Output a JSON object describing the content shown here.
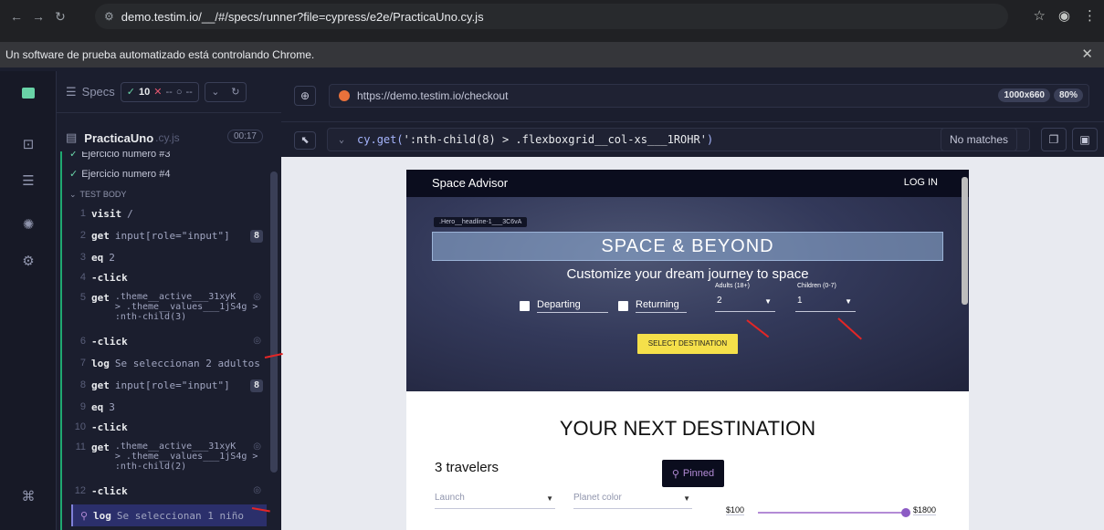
{
  "browser": {
    "url": "demo.testim.io/__/#/specs/runner?file=cypress/e2e/PracticaUno.cy.js",
    "automation_banner": "Un software de prueba automatizado está controlando Chrome."
  },
  "reporter": {
    "specs_label": "Specs",
    "passed": "10",
    "failed": "--",
    "pending": "--",
    "spec_name": "PracticaUno",
    "spec_ext": ".cy.js",
    "duration": "00:17",
    "test_prev": "Ejercicio numero #3",
    "test_current": "Ejercicio numero #4",
    "section": "TEST BODY",
    "commands": [
      {
        "num": "1",
        "name": "visit",
        "msg": "/"
      },
      {
        "num": "2",
        "name": "get",
        "msg": "input[role=\"input\"]",
        "badge": "8"
      },
      {
        "num": "3",
        "name": "eq",
        "msg": "2"
      },
      {
        "num": "4",
        "name": "-click",
        "msg": ""
      },
      {
        "num": "5",
        "name": "get",
        "msg": ".theme__active___31xyK\n> .theme__values___1jS4g >\n:nth-child(3)"
      },
      {
        "num": "6",
        "name": "-click",
        "msg": ""
      },
      {
        "num": "7",
        "name": "log",
        "msg": "Se seleccionan 2 adultos"
      },
      {
        "num": "8",
        "name": "get",
        "msg": "input[role=\"input\"]",
        "badge": "8"
      },
      {
        "num": "9",
        "name": "eq",
        "msg": "3"
      },
      {
        "num": "10",
        "name": "-click",
        "msg": ""
      },
      {
        "num": "11",
        "name": "get",
        "msg": ".theme__active___31xyK\n> .theme__values___1jS4g >\n:nth-child(2)"
      },
      {
        "num": "12",
        "name": "-click",
        "msg": ""
      },
      {
        "num": "",
        "name": "log",
        "msg": "Se seleccionan 1 niño"
      }
    ]
  },
  "aut": {
    "url": "https://demo.testim.io/checkout",
    "viewport": "1000x660",
    "zoom": "80%",
    "selector_fn": "cy.get(",
    "selector_arg": "':nth-child(8) > .flexboxgrid__col-xs___1ROHR'",
    "selector_close": ")",
    "no_matches": "No matches"
  },
  "app": {
    "logo": "Space Advisor",
    "login": "LOG IN",
    "hero_tag": ".Hero__headline-1___3C6vA",
    "hero_title": "SPACE & BEYOND",
    "hero_subtitle": "Customize your dream journey to space",
    "departing": "Departing",
    "returning": "Returning",
    "adults_label": "Adults (18+)",
    "adults_value": "2",
    "children_label": "Children (0-7)",
    "children_value": "1",
    "select_destination": "SELECT DESTINATION",
    "next_destination": "YOUR NEXT DESTINATION",
    "travelers": "3 travelers",
    "pinned": "Pinned",
    "launch": "Launch",
    "planet_color": "Planet color",
    "price_min": "$100",
    "price_max": "$1800"
  },
  "colors": {
    "accent_green": "#69d3a7",
    "arrow_red": "#e32626",
    "button_yellow": "#f5e04a"
  }
}
